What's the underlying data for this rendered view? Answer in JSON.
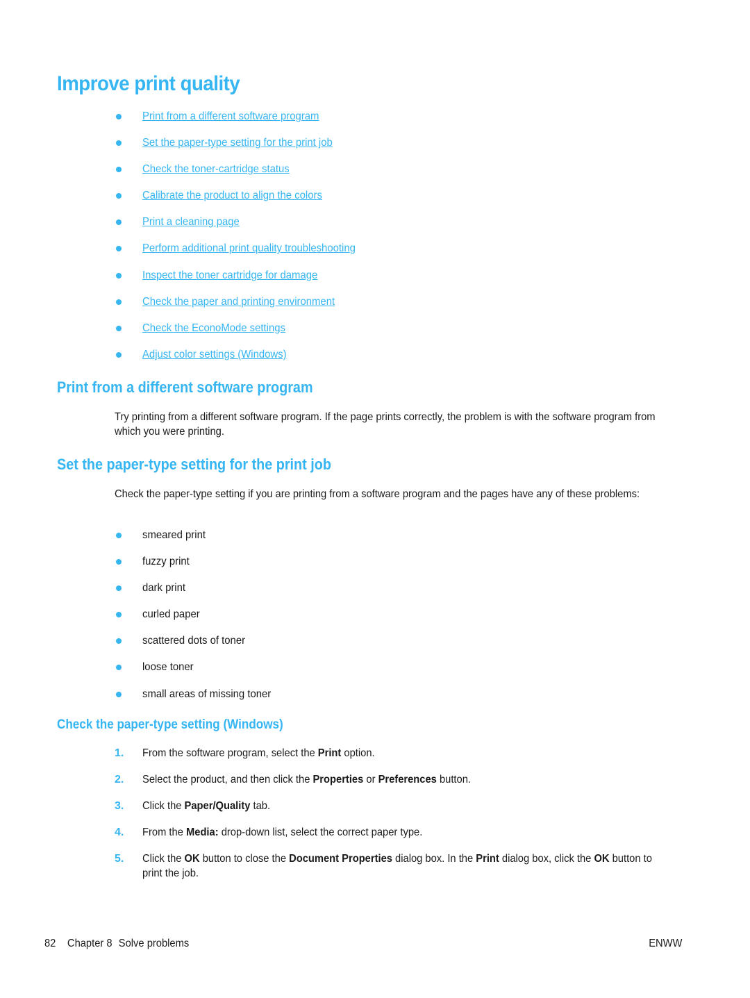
{
  "page": {
    "title": "Improve print quality",
    "accent_color": "#35b5f1"
  },
  "toc": [
    {
      "label": "Print from a different software program"
    },
    {
      "label": "Set the paper-type setting for the print job"
    },
    {
      "label": "Check the toner-cartridge status"
    },
    {
      "label": "Calibrate the product to align the colors"
    },
    {
      "label": "Print a cleaning page"
    },
    {
      "label": "Perform additional print quality troubleshooting"
    },
    {
      "label": "Inspect the toner cartridge for damage"
    },
    {
      "label": "Check the paper and printing environment"
    },
    {
      "label": "Check the EconoMode settings"
    },
    {
      "label": "Adjust color settings (Windows)"
    }
  ],
  "section1": {
    "heading": "Print from a different software program",
    "body": "Try printing from a different software program. If the page prints correctly, the problem is with the software program from which you were printing."
  },
  "section2": {
    "heading": "Set the paper-type setting for the print job",
    "body": "Check the paper-type setting if you are printing from a software program and the pages have any of these problems:",
    "problems": [
      "smeared print",
      "fuzzy print",
      "dark print",
      "curled paper",
      "scattered dots of toner",
      "loose toner",
      "small areas of missing toner"
    ]
  },
  "subsection": {
    "heading": "Check the paper-type setting (Windows)",
    "steps": [
      {
        "num": "1.",
        "parts": [
          {
            "t": "From the software program, select the "
          },
          {
            "b": "Print"
          },
          {
            "t": " option."
          }
        ]
      },
      {
        "num": "2.",
        "parts": [
          {
            "t": "Select the product, and then click the "
          },
          {
            "b": "Properties"
          },
          {
            "t": " or "
          },
          {
            "b": "Preferences"
          },
          {
            "t": " button."
          }
        ]
      },
      {
        "num": "3.",
        "parts": [
          {
            "t": "Click the "
          },
          {
            "b": "Paper/Quality"
          },
          {
            "t": " tab."
          }
        ]
      },
      {
        "num": "4.",
        "parts": [
          {
            "t": "From the "
          },
          {
            "b": "Media:"
          },
          {
            "t": " drop-down list, select the correct paper type."
          }
        ]
      },
      {
        "num": "5.",
        "parts": [
          {
            "t": "Click the "
          },
          {
            "b": "OK"
          },
          {
            "t": " button to close the "
          },
          {
            "b": "Document Properties"
          },
          {
            "t": " dialog box. In the "
          },
          {
            "b": "Print"
          },
          {
            "t": " dialog box, click the "
          },
          {
            "b": "OK"
          },
          {
            "t": " button to print the job."
          }
        ]
      }
    ]
  },
  "footer": {
    "page_number": "82",
    "chapter": "Chapter 8",
    "section": "Solve problems",
    "locale": "ENWW"
  }
}
